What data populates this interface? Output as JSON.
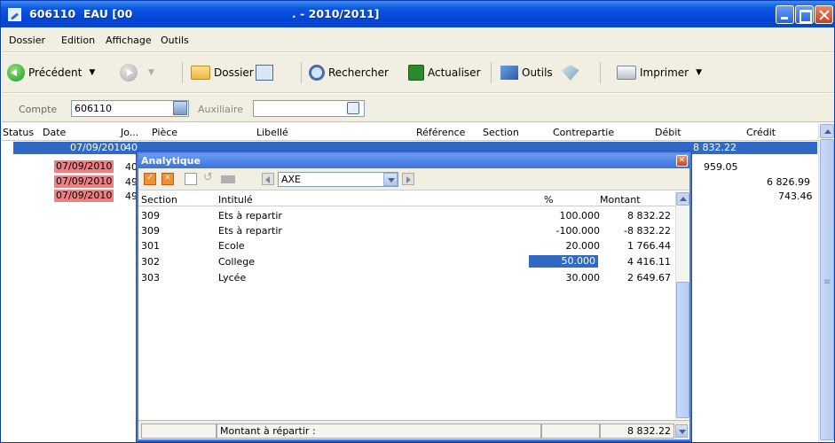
{
  "window": {
    "title_left": "606110  EAU [00",
    "title_right": ". - 2010/2011]"
  },
  "menu": [
    "Dossier",
    "Edition",
    "Affichage",
    "Outils"
  ],
  "toolbar": {
    "back_label": "Précédent",
    "dossier_label": "Dossier",
    "search_label": "Rechercher",
    "refresh_label": "Actualiser",
    "tools_label": "Outils",
    "print_label": "Imprimer"
  },
  "filter": {
    "compte_label": "Compte",
    "compte_value": "606110",
    "auxiliaire_label": "Auxiliaire",
    "auxiliaire_value": ""
  },
  "grid": {
    "columns": [
      "Status",
      "Date",
      "Jo...",
      "Pièce",
      "Libellé",
      "Référence",
      "Section",
      "Contrepartie",
      "Débit",
      "Crédit"
    ],
    "rows": [
      {
        "date": "07/09/2010",
        "journal": "40",
        "debit": "8 832.22",
        "credit": ""
      },
      {
        "date": "07/09/2010",
        "journal": "40",
        "debit": "959.05",
        "credit": ""
      },
      {
        "date": "07/09/2010",
        "journal": "49",
        "debit": "",
        "credit": "6 826.99"
      },
      {
        "date": "07/09/2010",
        "journal": "49",
        "debit": "",
        "credit": "743.46"
      }
    ]
  },
  "dialog": {
    "title": "Analytique",
    "close_glyph": "✕",
    "axis_value": "AXE",
    "columns": [
      "Section",
      "Intitulé",
      "%",
      "Montant"
    ],
    "rows": [
      {
        "section": "309",
        "intitule": "Ets à repartir",
        "pct": "100.000",
        "montant": "8 832.22"
      },
      {
        "section": "309",
        "intitule": "Ets à repartir",
        "pct": "-100.000",
        "montant": "-8 832.22"
      },
      {
        "section": "301",
        "intitule": "Ecole",
        "pct": "20.000",
        "montant": "1 766.44"
      },
      {
        "section": "302",
        "intitule": "College",
        "pct": "50.000",
        "montant": "4 416.11"
      },
      {
        "section": "303",
        "intitule": "Lycée",
        "pct": "30.000",
        "montant": "2 649.67"
      }
    ],
    "footer_label": "Montant à répartir :",
    "footer_value": "8 832.22"
  }
}
